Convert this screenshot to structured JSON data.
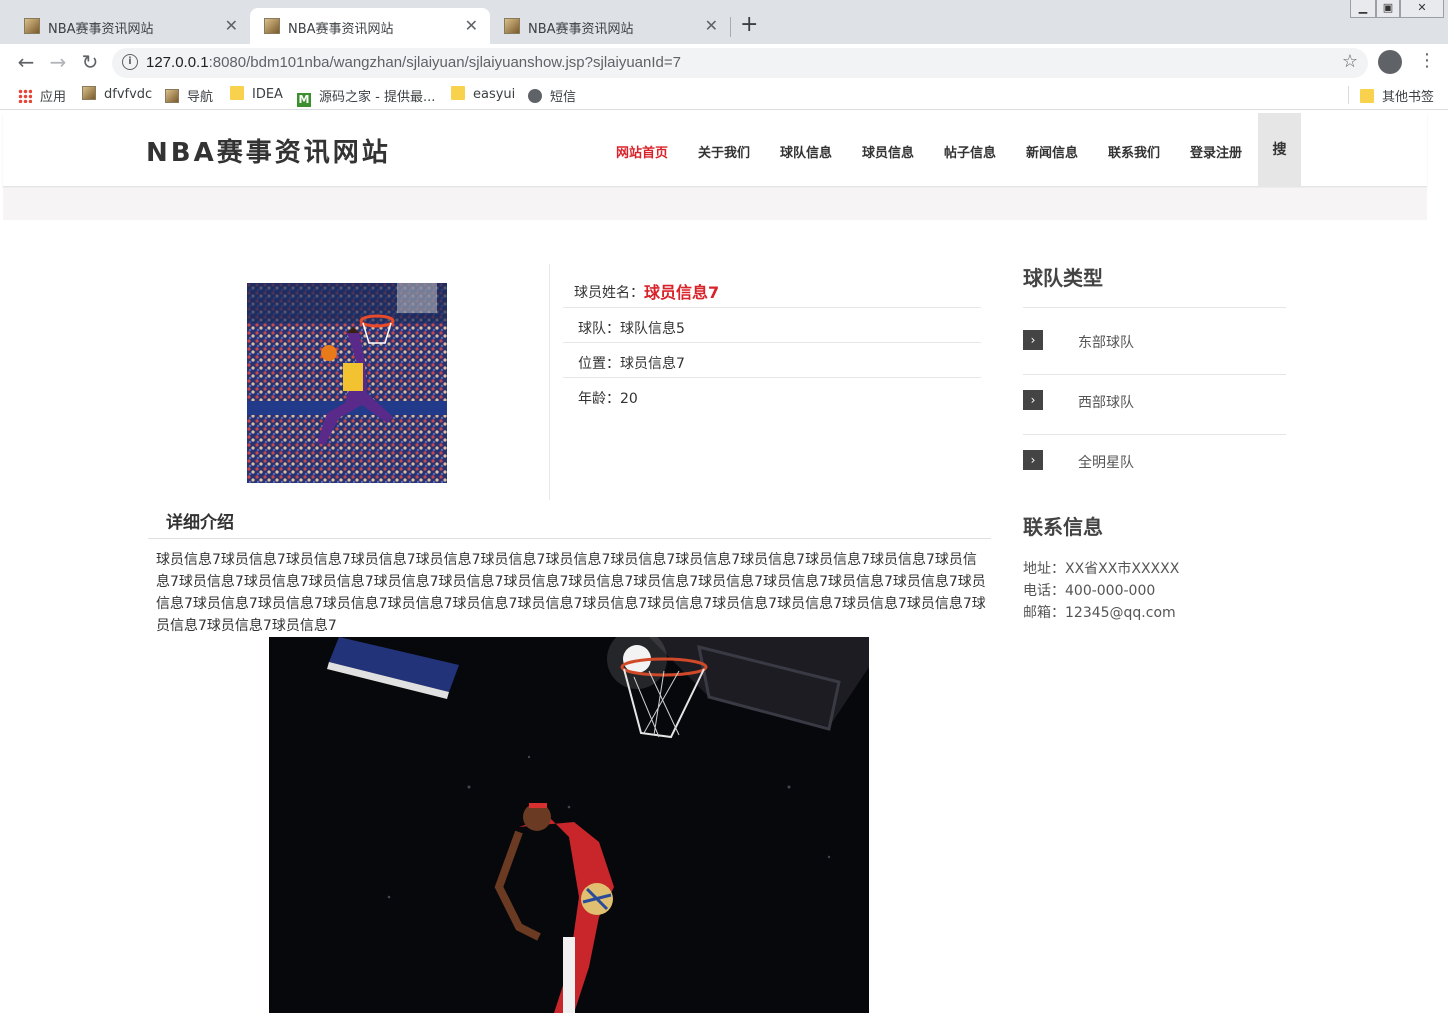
{
  "browser": {
    "tabs": [
      {
        "title": "NBA赛事资讯网站",
        "close": "✕"
      },
      {
        "title": "NBA赛事资讯网站",
        "close": "✕"
      },
      {
        "title": "NBA赛事资讯网站",
        "close": "✕"
      }
    ],
    "new_tab": "+",
    "url_host": "127.0.0.1",
    "url_rest": ":8080/bdm101nba/wangzhan/sjlaiyuan/sjlaiyuanshow.jsp?sjlaiyuanId=7",
    "bookmarks": [
      {
        "label": "应用",
        "icon": "apps-icon"
      },
      {
        "label": "dfvfvdc",
        "icon": "image-icon"
      },
      {
        "label": "导航",
        "icon": "image-icon"
      },
      {
        "label": "IDEA",
        "icon": "folder-icon"
      },
      {
        "label": "源码之家 - 提供最...",
        "icon": "m-icon"
      },
      {
        "label": "easyui",
        "icon": "folder-icon"
      },
      {
        "label": "短信",
        "icon": "globe-icon"
      }
    ],
    "other_bookmarks": "其他书签"
  },
  "site": {
    "logo": "NBA赛事资讯网站",
    "nav": [
      "网站首页",
      "关于我们",
      "球队信息",
      "球员信息",
      "帖子信息",
      "新闻信息",
      "联系我们",
      "登录注册"
    ],
    "search": "搜",
    "accent_color": "#d8232a"
  },
  "player": {
    "name_label": "球员姓名：",
    "name": "球员信息7",
    "team": "球队：球队信息5",
    "position": "位置：球员信息7",
    "age": "年龄：20"
  },
  "detail": {
    "title": "详细介绍",
    "text": "球员信息7球员信息7球员信息7球员信息7球员信息7球员信息7球员信息7球员信息7球员信息7球员信息7球员信息7球员信息7球员信息7球员信息7球员信息7球员信息7球员信息7球员信息7球员信息7球员信息7球员信息7球员信息7球员信息7球员信息7球员信息7球员信息7球员信息7球员信息7球员信息7球员信息7球员信息7球员信息7球员信息7球员信息7球员信息7球员信息7球员信息7球员信息7球员信息7球员信息7球员信息7"
  },
  "sidebar": {
    "team_types_title": "球队类型",
    "team_types": [
      "东部球队",
      "西部球队",
      "全明星队"
    ],
    "contact_title": "联系信息",
    "address": "地址：XX省XX市XXXXX",
    "phone": "电话：400-000-000",
    "email": "邮箱：12345@qq.com"
  }
}
